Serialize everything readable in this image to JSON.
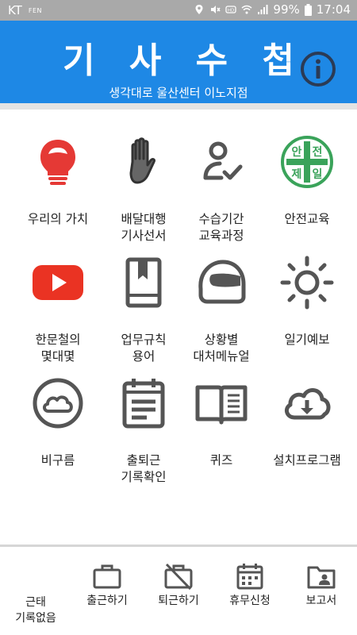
{
  "status_bar": {
    "carrier": "KT",
    "small_text": "FEN",
    "battery": "99%",
    "time": "17:04"
  },
  "header": {
    "title": "기 사 수 첩",
    "subtitle": "생각대로 울산센터 이노지점",
    "info_icon": "info-circle-icon",
    "background": "#1e88e5"
  },
  "grid": [
    {
      "label": "우리의 가치",
      "icon": "lightbulb-icon"
    },
    {
      "label": "배달대행\n기사선서",
      "icon": "raised-hand-icon"
    },
    {
      "label": "수습기간\n교육과정",
      "icon": "user-check-icon"
    },
    {
      "label": "안전교육",
      "icon": "safety-first-badge-icon",
      "badge_text": [
        "안",
        "전",
        "제",
        "일"
      ]
    },
    {
      "label": "한문철의\n몇대몇",
      "icon": "youtube-play-icon"
    },
    {
      "label": "업무규칙\n용어",
      "icon": "bookmark-book-icon"
    },
    {
      "label": "상황별\n대처메뉴얼",
      "icon": "helmet-icon"
    },
    {
      "label": "일기예보",
      "icon": "sun-icon"
    },
    {
      "label": "비구름",
      "icon": "cloud-circle-icon"
    },
    {
      "label": "출퇴근\n기록확인",
      "icon": "calendar-list-icon"
    },
    {
      "label": "퀴즈",
      "icon": "open-book-icon"
    },
    {
      "label": "설치프로그램",
      "icon": "cloud-download-icon"
    }
  ],
  "bottom_nav": [
    {
      "label": "근태\n기록없음",
      "icon": ""
    },
    {
      "label": "출근하기",
      "icon": "briefcase-icon"
    },
    {
      "label": "퇴근하기",
      "icon": "briefcase-off-icon"
    },
    {
      "label": "휴무신청",
      "icon": "calendar-icon"
    },
    {
      "label": "보고서",
      "icon": "folder-user-icon"
    }
  ]
}
